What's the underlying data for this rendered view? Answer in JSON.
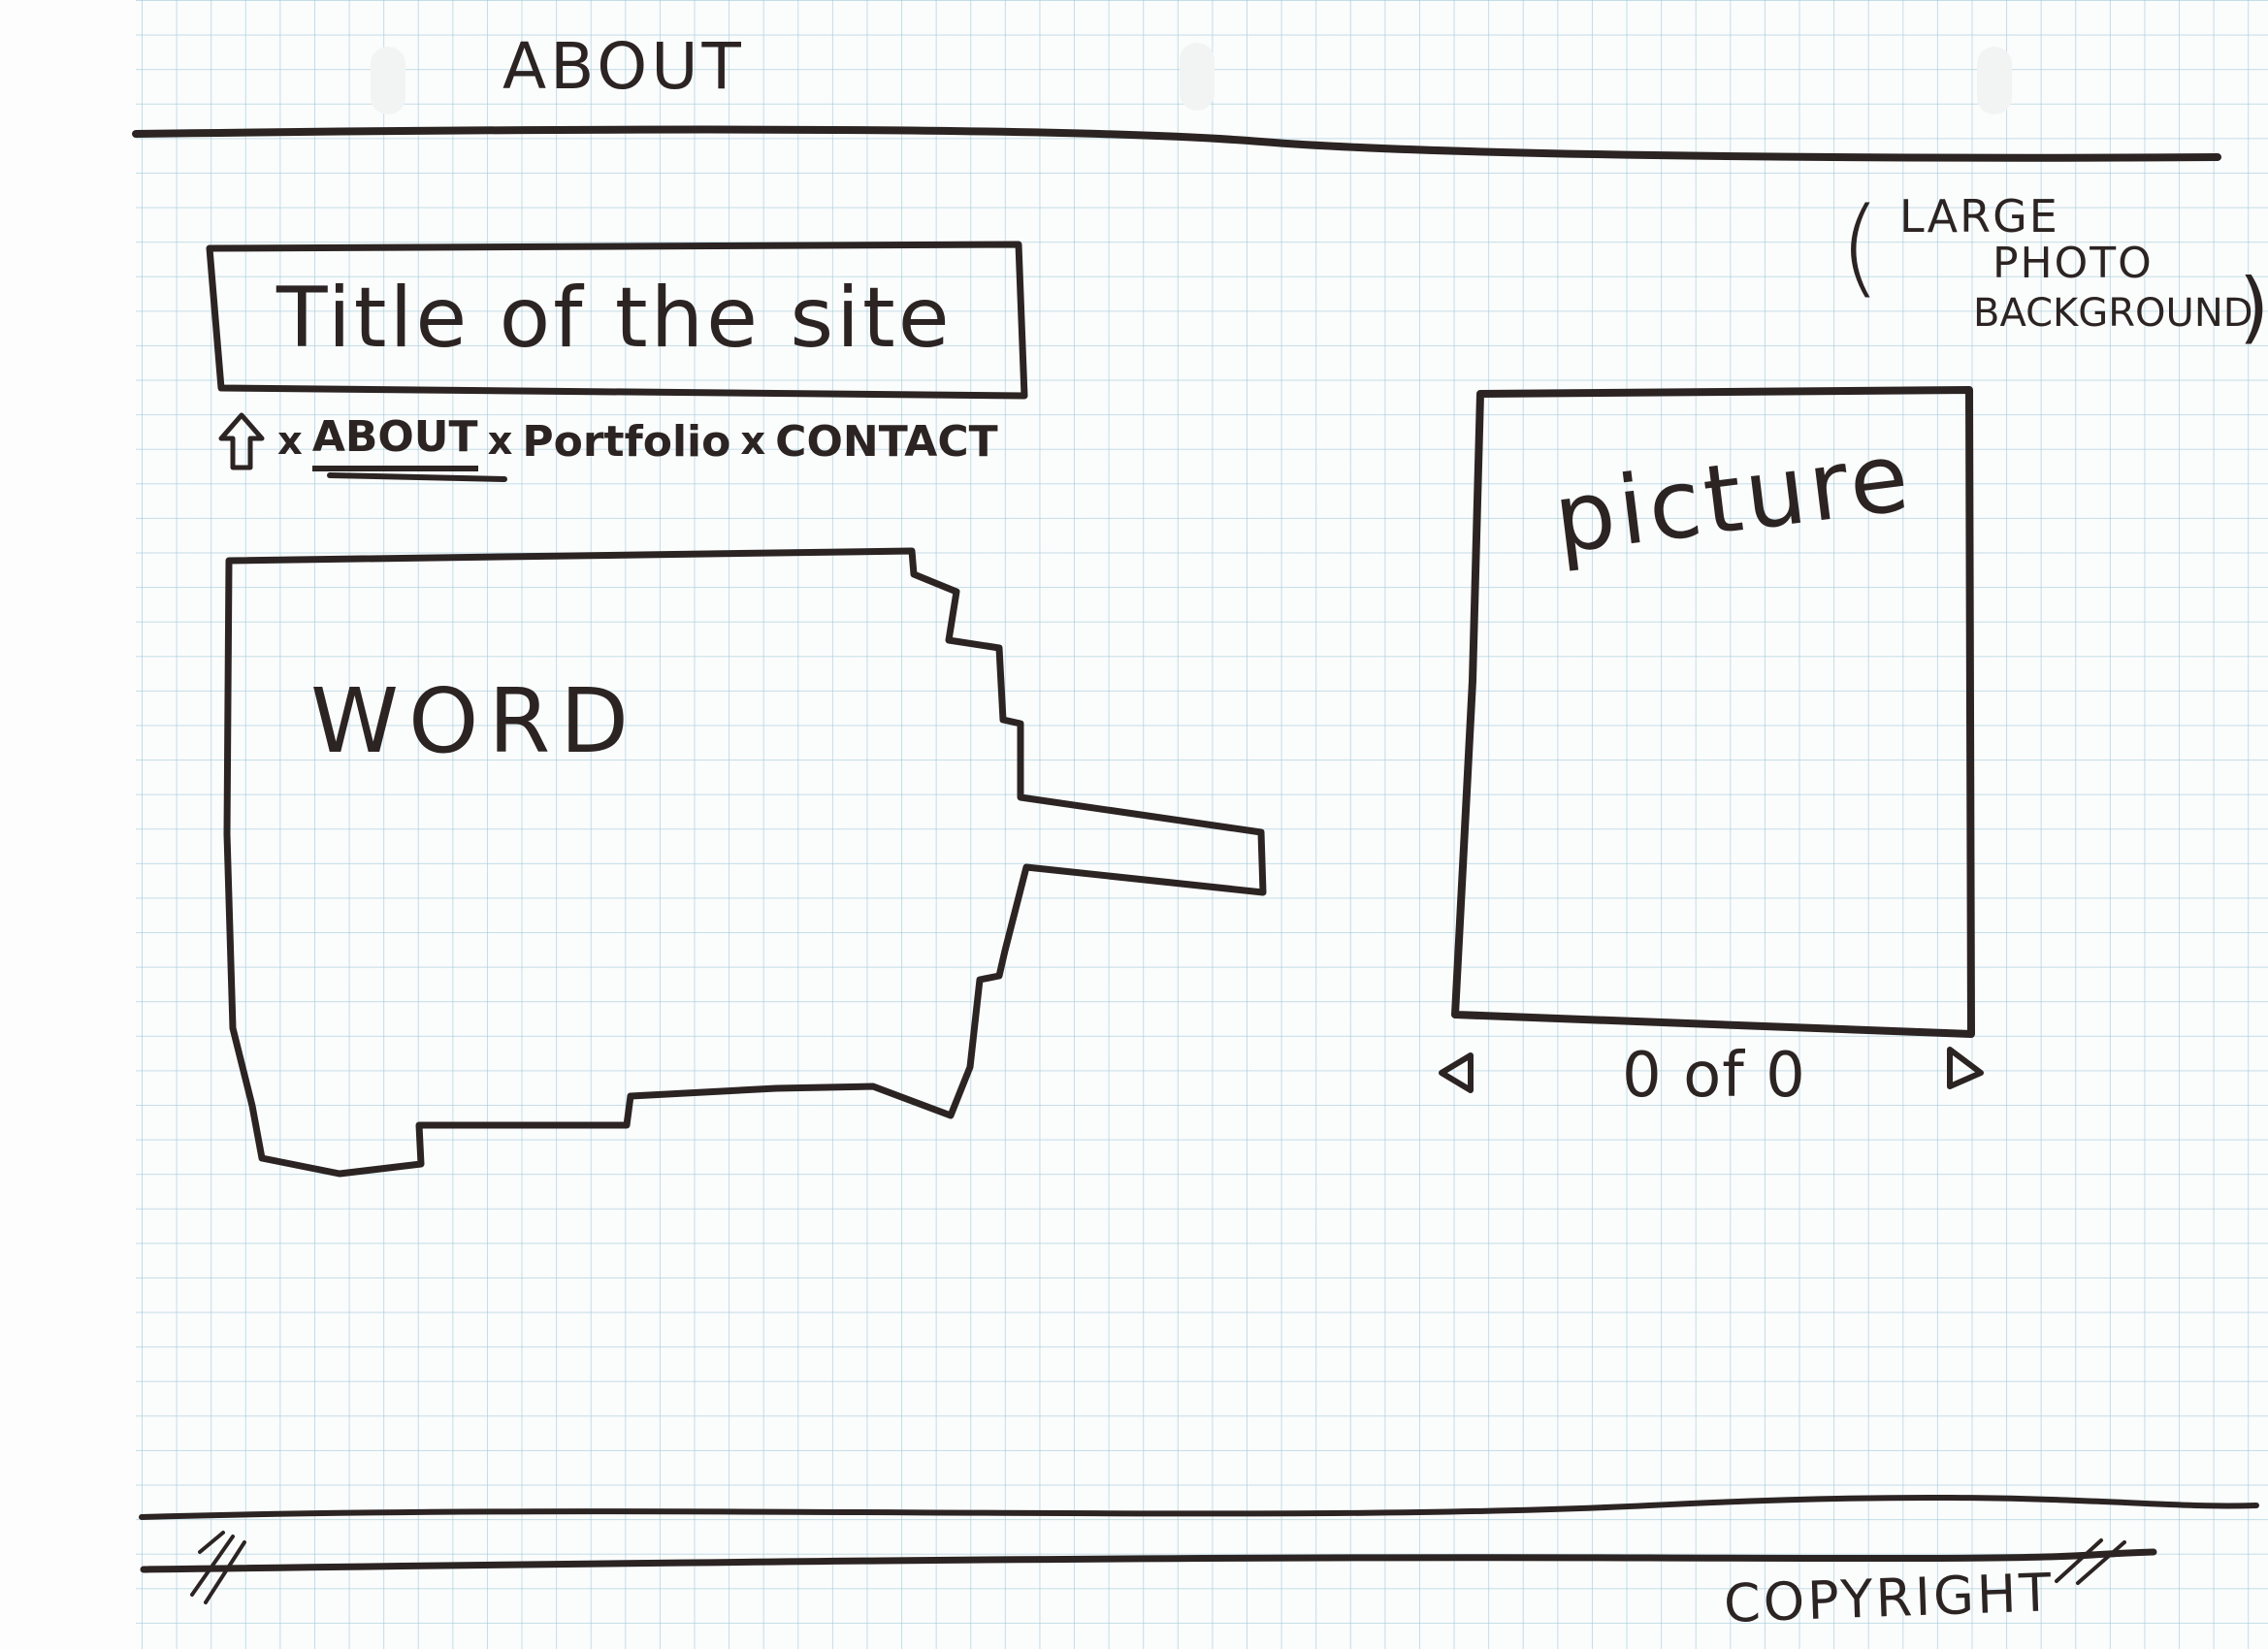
{
  "header": {
    "nav_label": "ABOUT"
  },
  "site": {
    "title": "Title of the site"
  },
  "nav": {
    "home_icon": "home-arrow-icon",
    "separator": "x",
    "items": [
      {
        "label": "ABOUT",
        "active": true
      },
      {
        "label": "Portfolio",
        "active": false
      },
      {
        "label": "CONTACT",
        "active": false
      }
    ]
  },
  "content": {
    "word_label": "WORD"
  },
  "gallery": {
    "picture_label": "picture",
    "counter_text": "0 of 0",
    "prev_icon": "triangle-left-icon",
    "next_icon": "triangle-right-icon"
  },
  "background_note": {
    "line1": "LARGE",
    "line2": "PHOTO",
    "line3": "BACKGROUND"
  },
  "footer": {
    "copyright": "COPYRIGHT"
  },
  "colors": {
    "ink": "#2b2423",
    "grid": "#96c4d6",
    "paper": "#fbfcfc"
  }
}
